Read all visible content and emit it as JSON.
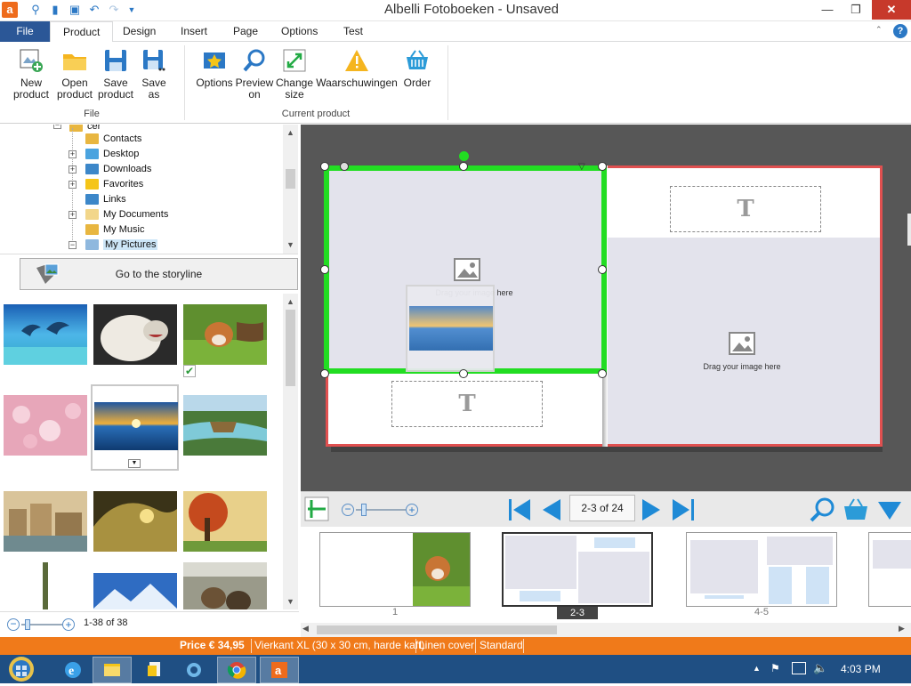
{
  "window": {
    "title": "Albelli Fotoboeken - Unsaved",
    "app_icon_letter": "a",
    "minimize": "—",
    "restore": "❐",
    "close": "✕"
  },
  "quick_access": [
    "search-icon",
    "folder-icon",
    "save-icon",
    "undo-icon",
    "redo-icon",
    "dropdown-icon"
  ],
  "tabs": [
    {
      "label": "File"
    },
    {
      "label": "Product"
    },
    {
      "label": "Design"
    },
    {
      "label": "Insert"
    },
    {
      "label": "Page"
    },
    {
      "label": "Options"
    },
    {
      "label": "Test"
    }
  ],
  "ribbon": {
    "file_group": {
      "label": "File",
      "buttons": [
        {
          "line1": "New",
          "line2": "product"
        },
        {
          "line1": "Open",
          "line2": "product"
        },
        {
          "line1": "Save",
          "line2": "product"
        },
        {
          "line1": "Save",
          "line2": "as"
        }
      ]
    },
    "current_group": {
      "label": "Current product",
      "buttons": [
        {
          "line1": "Options",
          "line2": ""
        },
        {
          "line1": "Preview",
          "line2": "on"
        },
        {
          "line1": "Change",
          "line2": "size"
        },
        {
          "line1": "Waarschuwingen",
          "line2": ""
        },
        {
          "line1": "Order",
          "line2": ""
        }
      ]
    },
    "help": "?"
  },
  "tree": {
    "items": [
      {
        "label": "Contacts",
        "expandable": false
      },
      {
        "label": "Desktop",
        "expandable": true
      },
      {
        "label": "Downloads",
        "expandable": true
      },
      {
        "label": "Favorites",
        "expandable": true
      },
      {
        "label": "Links",
        "expandable": false
      },
      {
        "label": "My Documents",
        "expandable": true
      },
      {
        "label": "My Music",
        "expandable": false
      },
      {
        "label": "My Pictures",
        "expandable": true,
        "selected": true
      }
    ],
    "partial_top": "cer"
  },
  "storyline": {
    "label": "Go to the storyline"
  },
  "gallery": {
    "count_label": "1-38 of 38"
  },
  "editor": {
    "left_page": {
      "drag_text": "Drag your image here",
      "text_placeholder": "T"
    },
    "right_page": {
      "drag_text": "Drag your image here",
      "text_placeholder": "T"
    },
    "page_counter": "2-3 of 24"
  },
  "thumbnails": [
    {
      "label": "1"
    },
    {
      "label": "2-3",
      "selected": true
    },
    {
      "label": "4-5"
    }
  ],
  "status": {
    "price": "Price € 34,95",
    "format": "Vierkant XL (30 x 30 cm, harde kaft)",
    "cover": "Linen cover",
    "paper": "Standard"
  },
  "taskbar": {
    "time": "4:03 PM"
  },
  "colors": {
    "accent": "#2b5797",
    "status_orange": "#f07a1a",
    "selection_green": "#22dd22",
    "page_border_red": "#e05050",
    "canvas_gray": "#575757"
  }
}
